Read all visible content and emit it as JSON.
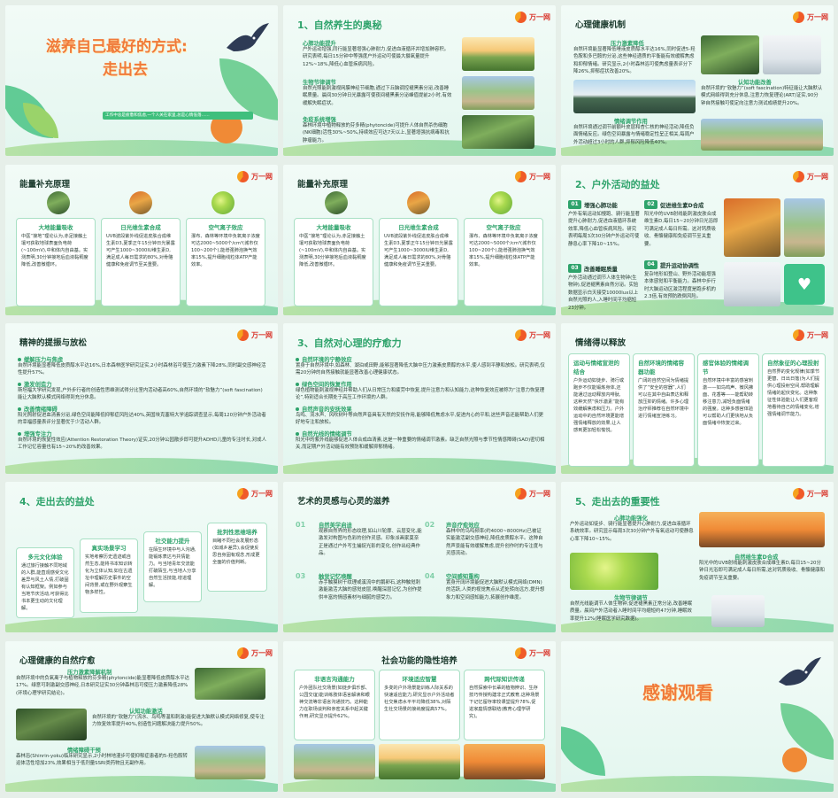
{
  "logo": "万一网",
  "s1": {
    "title_line1": "滋养自己最好的方式:",
    "title_line2": "走出去",
    "subtitle": "工作中总是疲惫和焦虑,一个人关在家里,总是心情低落……"
  },
  "s2": {
    "title": "1、自然养生的奥秘",
    "items": [
      {
        "h": "心肺功能提升",
        "t": "户外运动增强,同行能显著增强心肺耐力,促进血液循环并增加肺容积。研究表明,每日15分钟中等强度户外运动可使最大摄氧量提升12%~18%,降低心血管疾病风险。"
      },
      {
        "h": "生物节律调节",
        "t": "自然光照能刺激视网膜神经节细胞,通过下丘脑调控褪黑素分泌,改善睡眠质量。晨间30分钟日光暴露可使夜间褪黑素分泌峰值提前2小时,有效缓解失眠症状。"
      },
      {
        "h": "免疫系统增强",
        "t": "森林环境中植物释放的芬多精(phytoncide)可提升人体自然杀伤细胞(NK细胞)活性30%~50%,持续效应可达7天以上,显著增强抗病毒和抗肿瘤能力。"
      }
    ]
  },
  "s3": {
    "title": "心理健康机制",
    "items": [
      {
        "h": "压力激素降低",
        "t": "自然环境能显著降低唾液皮质醇水平达16%,同时促进5-羟色胺和多巴胺的分泌,这些神经递质的平衡能有效缓解焦虑和抑郁情绪。研究显示,2小时森林浴可使焦虑量表评分下降26%,抑郁症状改善20%。"
      },
      {
        "h": "认知功能改善",
        "t": "自然环境的“软魅力”(soft fascination)特征能让大脑默认模式网络得到充分休息,注意力恢复理论(ART)证实,90分钟自然接触可使定向注意力测试成绩提升20%。"
      },
      {
        "h": "情绪调节作用",
        "t": "自然环境通过调节前额叶皮层和杏仁核的神经活动,降低负面情绪反应。绿色空间暴露与情绪稳定性呈正相关,每周户外活动超过3小时的人群,抑郁风险降低40%。"
      }
    ]
  },
  "energy": {
    "title": "能量补充原理",
    "cards": [
      {
        "h": "大地能量吸收",
        "t": "中医“接地”理论认为,赤足接触土壤可获取地球表面负电荷(~100mV),中和体内自由基。实测表明,30分钟接地后血液黏稠度降低,改善微循环。"
      },
      {
        "h": "日光维生素合成",
        "t": "UVB波段紫外线促进皮肤合成维生素D3,夏季正午15分钟日光暴露可产生1000~3000IU维生素D,满足成人每日需求的80%,对骨骼健康和免疫调节至关重要。"
      },
      {
        "h": "空气离子效应",
        "t": "瀑布、森林等环境中负氧离子浓度可达2000~5000个/cm³(城市仅100~200个),能增强肺泡换气效率15%,提升细胞线粒体ATP产能效率。"
      }
    ]
  },
  "s6": {
    "title": "2、户外活动的益处",
    "items": [
      {
        "n": "01",
        "h": "增强心肺功能",
        "t": "户外有氧运动如慢跑、骑行能显著提升心肺耐力,促进血液循环系统效率,降低心血管疾病风险。研究表明每周3次30分钟户外运动可使静息心率下降10~15%。"
      },
      {
        "n": "02",
        "h": "促进维生素D合成",
        "t": "阳光中的UVB射线能刺激皮肤合成维生素D,每日15~20分钟日光浴即可满足成人每日所需。这对钙质吸收、骨骼健康和免疫调节至关重要。"
      },
      {
        "n": "03",
        "h": "改善睡眠质量",
        "t": "户外活动通过调节人体生物钟(生物钟),促进褪黑素自然分泌。实验数据显示白天接受10000lux以上自然光照的人,入睡时间平均缩短23分钟。"
      },
      {
        "n": "04",
        "h": "提升运动协调性",
        "t": "复杂地形如登山、野外活动能增强本体感觉和平衡能力。森林中步行时大脑运动区激活程度是跑步机的2.3倍,有效预防跌倒风险。"
      }
    ]
  },
  "s7": {
    "title": "精神的提振与放松",
    "items": [
      {
        "h": "缓解压力与焦虑",
        "t": "自然环境能显著降低皮质醇水平达16%,日本森林医学研究证实,2小时森林浴可使压力激素下降28%,同时副交感神经活性提升57%。"
      },
      {
        "h": "激发创造力",
        "t": "斯坦福大学研究发现,户外步行者的创造性思维测试得分比室内活动者高60%,自然环境的“软魅力”(soft fascination)能让大脑默认模式网络得到充分休息。"
      },
      {
        "h": "改善情绪障碍",
        "t": "阳光照射促进血清素分泌,绿色空间能降低抑郁症风险达40%,英国埃克塞特大学追踪调查显示,每周120分钟户外活动者的幸福感量表评分显著优于少活动人群。"
      },
      {
        "h": "增强专注力",
        "t": "自然环境的恢复性效应(Attention Restoration Theory)证实,20分钟公园散步即可提升ADHD儿童的专注时长,对成人工作记忆容量也有15~20%的改善效果。"
      }
    ]
  },
  "s8": {
    "title": "3、自然对心理的疗愈力",
    "items": [
      {
        "h": "自然环境的宁静效应",
        "t": "置身于自然环境中,如森林、湖泊或田野,能够显著降低大脑中压力激素皮质醇的水平,使人感到平静和放松。研究表明,仅需20分钟的自然接触就能显著改善心理健康状态。"
      },
      {
        "h": "绿色空间的恢复作用",
        "t": "绿色植物能刺激视神经并帮助人们从日常压力和疲劳中恢复,提升注意力和认知能力,这种恢复效应被称为“注意力恢复理论”,特别适合长期处于高压工作环境的人群。"
      },
      {
        "h": "自然声音的安抚效果",
        "t": "鸟鸣、流水声、风吹树叶等自然声音具有天然的安抚作用,能够降低焦虑水平,促进内心的平和,这些声音还能帮助人们更好地专注和放松。"
      },
      {
        "h": "自然光线的情绪调节",
        "t": "阳光中的紫外线能够促进人体合成血清素,这是一种重要的情绪调节激素。缺乏自然光照与季节性情感障碍(SAD)密切相关,而定期户外活动能有效预防和缓解抑郁情绪。"
      }
    ]
  },
  "s9": {
    "title": "情绪得以释放",
    "cards": [
      {
        "h": "运动与情绪宣泄的结合",
        "t": "户外运动如徒步、骑行或跑步不仅能锻炼身体,还能通过运动释放内啡肽,这种天然“快乐激素”能有效缓解焦虑和压力。户外运动中的自然环境更能增强情绪释放的效果,让人感到更加轻松愉悦。"
      },
      {
        "h": "自然环境的情绪容器功能",
        "t": "广阔的自然空间为情绪提供了“安全的容器”,人们可以在其中自由表达和释放压抑的情绪。许多心理治疗师推荐在自然环境中进行情绪宣泄练习。"
      },
      {
        "h": "感官体验的情绪调节",
        "t": "自然环境中丰富的感官刺激——如鸟鸣声、微风拂面、花香等——能帮助转移注意力,减轻负面情绪的强度。这种多感官体验可以帮助人们更快地从负面情绪中恢复过来。"
      },
      {
        "h": "自然象征的心理投射",
        "t": "自然界的变化规律(如季节更替、日出日落)为人们提供心理投射空间,帮助理解情绪的起伏变化。这种象征性体验能让人们更客观地看待自己的情绪变化,增强情绪调节能力。"
      }
    ]
  },
  "s10": {
    "title": "4、走出去的益处",
    "cards": [
      {
        "h": "多元文化体验",
        "t": "通过旅行接触不同地域的人群,能直观感受文化差异与风土人情,打破固有认知框架。例如参与当地节庆活动,可获得比书本更生动的文化理解。"
      },
      {
        "h": "真实场景学习",
        "t": "实地考察历史遗迹或自然生态,能将书本知识转化为立体认知,如在古遗址中理解历史事件的空间背景,或在野外观察生物多样性。"
      },
      {
        "h": "社交能力提升",
        "t": "在陌生环境中与人沟通,能锻炼表达与共情能力。与当地青年交流能打破陌生,与当地人分享自然生活技能,增进理解。"
      },
      {
        "h": "批判性思维培养",
        "t": "目睹不同社会发展形态(如城乡差异),会促使反思自身固有观念,形成更全面的价值判断。"
      }
    ]
  },
  "s11": {
    "title": "艺术的灵感与心灵的滋养",
    "items": [
      {
        "n": "01",
        "h": "自然美学启迪",
        "t": "观察自然界的形态纹理,如山川轮廓、云层变化,能激发对构图与色彩的创作灵感。印象派画家莫奈正是通过户外写生捕捉光影的变化,创作出经典作品。"
      },
      {
        "n": "02",
        "h": "声音疗愈效应",
        "t": "森林中的鸟鸣频率(约4000~8000Hz)已被证实能激活副交感神经,降低皮质醇水平。这种自然声景能有效缓解焦虑,提升创作时的专注度与灵感流动。"
      },
      {
        "n": "03",
        "h": "触觉记忆唤醒",
        "t": "赤手触摸树干纹理或溪流中的鹅卵石,这种触觉刺激能激活大脑的感觉皮层,唤醒深层记忆,为创作提供丰富的情感素材与细腻的感受力。"
      },
      {
        "n": "04",
        "h": "空间感知重构",
        "t": "置身开阔环境能促进大脑默认模式网络(DMN)的活跃,人类的视觉焦点从近处转向远方,提升想象力和空间感知能力,拓展创作维度。"
      }
    ]
  },
  "s12": {
    "title": "5、走出去的重要性",
    "items": [
      {
        "h": "心肺功能强化",
        "t": "户外运动如徒步、骑行能显著提升心肺耐力,促进血液循环系统效率。研究显示每周3次30分钟户外有氧运动可使静息心率下降10~15%。"
      },
      {
        "h": "自然维生素D合成",
        "t": "阳光中的UVB射线能刺激皮肤合成维生素D,每日15~20分钟日光浴即可满足成人每日所需,这对钙质吸收、骨骼健康和免疫调节至关重要。"
      },
      {
        "h": "生物节律调节",
        "t": "自然光线能调节人体生物钟,促进褪黑素正常分泌,改善睡眠质量。晨间户外活动者入睡时间平均缩短约47分钟,睡眠效率提升12%(睡眠医学研究数据)。"
      }
    ]
  },
  "s13": {
    "title": "心理健康的自然疗愈",
    "items": [
      {
        "h": "压力激素降解机制",
        "t": "自然环境中的负氧离子与植物释放的芬多精(phytoncide)能显著降低皮质醇水平达17%。绿意可刺激副交感神经,日本研究证实30分钟森林浴可使压力激素降低28%(环境心理学研究结论)。"
      },
      {
        "h": "认知功能激活",
        "t": "自然环境的“软魅力”(流水、鸟鸣等温和刺激)能促进大脑默认模式网络修复,使专注力恢复效率提升40%,创造性问题解决能力提升50%。"
      },
      {
        "h": "情绪障碍干预",
        "t": "森林浴(Shinrin-yoku)临床研究显示,2小时林地漫步可使抑郁症患者的5-羟色胺转运体活性增加23%,效果相当于低剂量SSRI类药物且无副作用。"
      }
    ]
  },
  "s14": {
    "title": "社会功能的隐性培养",
    "cards": [
      {
        "h": "非语言沟通能力",
        "t": "户外团队社交场景(如徒步俱乐部、公园交谊)能训练肢体语言解读和眼神交流等非语言沟通技巧。这种能力在职场谈判和亲密关系中起关键作用,研究显示提升62%。"
      },
      {
        "h": "环境适应智慧",
        "t": "多变的户外场景能训练人际关系的快速适应能力,研究显示户外活动者社交焦虑水平平均降低38%,对陌生社交场景的接纳度提高57%。"
      },
      {
        "h": "跨代际知识传递",
        "t": "自然探索中长辈的植物辨识、生存技巧传授构建非正式教育,这种场景下记忆留存率较课堂提升78%,促进家庭情感联结(教育心理学研究)。"
      }
    ]
  },
  "s15": {
    "title": "感谢观看"
  }
}
